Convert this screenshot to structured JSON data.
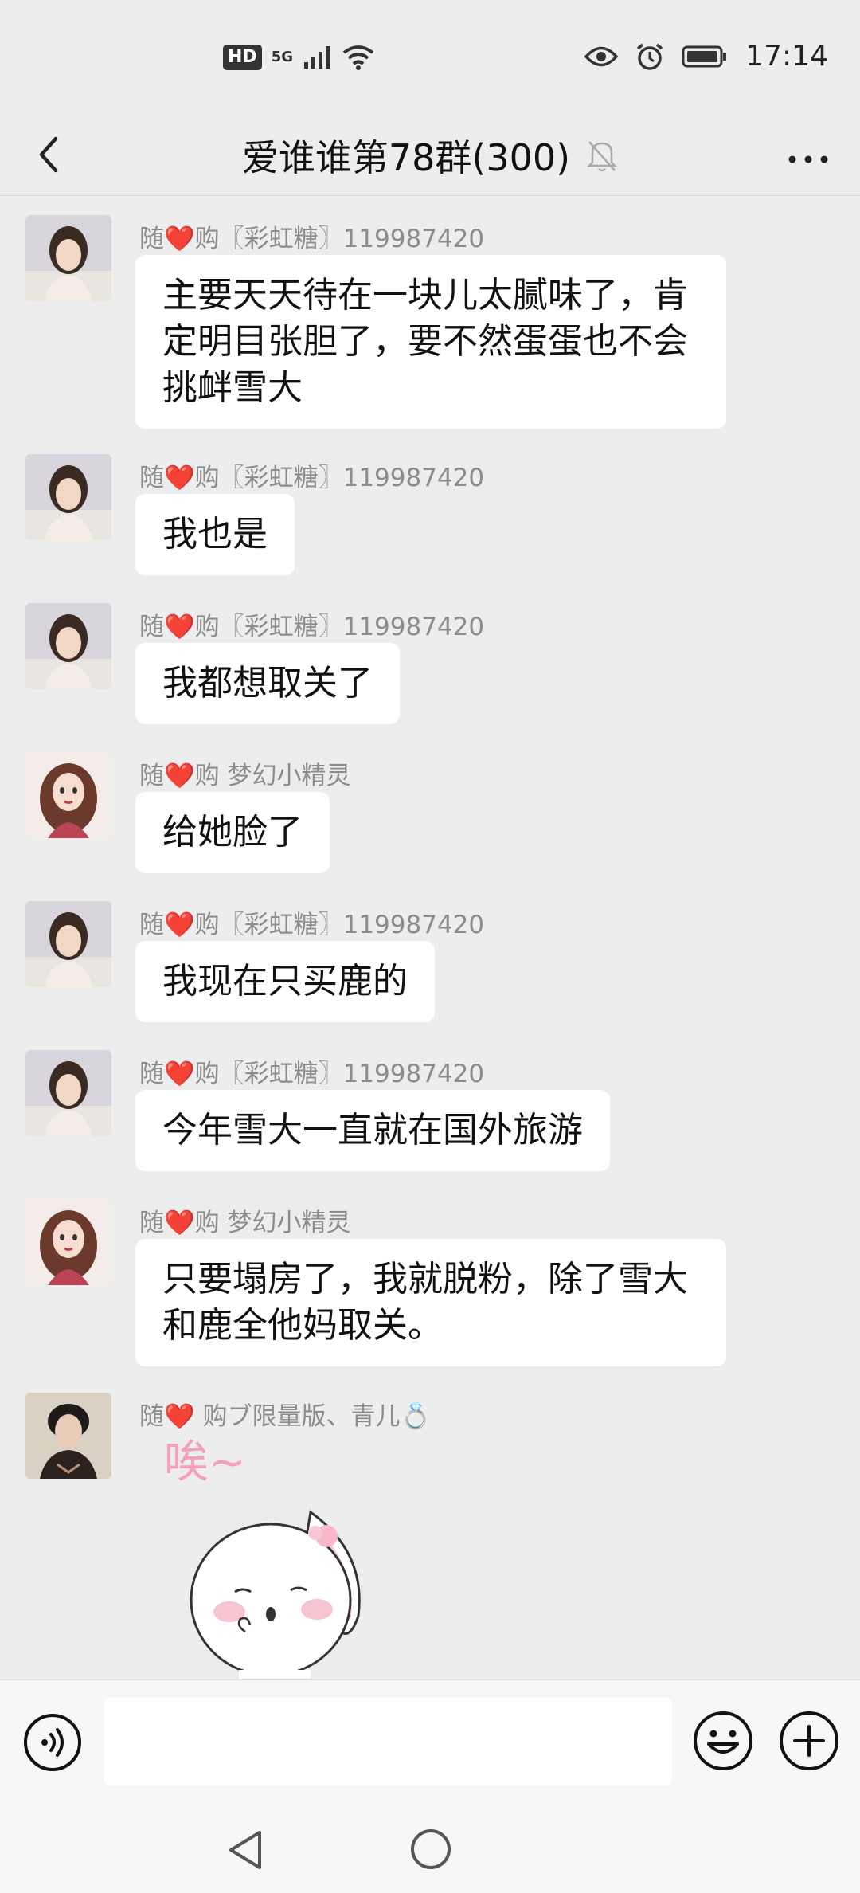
{
  "status_bar": {
    "hd": "HD",
    "network": "5G",
    "time": "17:14"
  },
  "header": {
    "title": "爱谁谁第78群(300)"
  },
  "messages": [
    {
      "sender_prefix": "随",
      "heart": "❤️",
      "sender_rest": "购〖彩虹糖〗119987420",
      "text_lines": [
        "主要天天待在一块儿太腻味了，肯",
        "定明目张胆了，要不然蛋蛋也不会",
        "挑衅雪大"
      ]
    },
    {
      "sender_prefix": "随",
      "heart": "❤️",
      "sender_rest": "购〖彩虹糖〗119987420",
      "text": "我也是"
    },
    {
      "sender_prefix": "随",
      "heart": "❤️",
      "sender_rest": "购〖彩虹糖〗119987420",
      "text": "我都想取关了"
    },
    {
      "sender_prefix": "随",
      "heart": "❤️",
      "sender_rest": "购  梦幻小精灵",
      "text": "给她脸了"
    },
    {
      "sender_prefix": "随",
      "heart": "❤️",
      "sender_rest": "购〖彩虹糖〗119987420",
      "text": "我现在只买鹿的"
    },
    {
      "sender_prefix": "随",
      "heart": "❤️",
      "sender_rest": "购〖彩虹糖〗119987420",
      "text": "今年雪大一直就在国外旅游"
    },
    {
      "sender_prefix": "随",
      "heart": "❤️",
      "sender_rest": "购  梦幻小精灵",
      "text_lines": [
        "只要塌房了，我就脱粉，除了雪大",
        "和鹿全他妈取关。"
      ]
    },
    {
      "sender_prefix": "随",
      "heart": "❤️",
      "sender_rest": " 购ブ限量版、青儿💍",
      "sticker_text": "唉~"
    }
  ],
  "colors": {
    "background": "#ededed",
    "bubble": "#ffffff",
    "name": "#8c8c8c",
    "heart": "#e0283a"
  }
}
